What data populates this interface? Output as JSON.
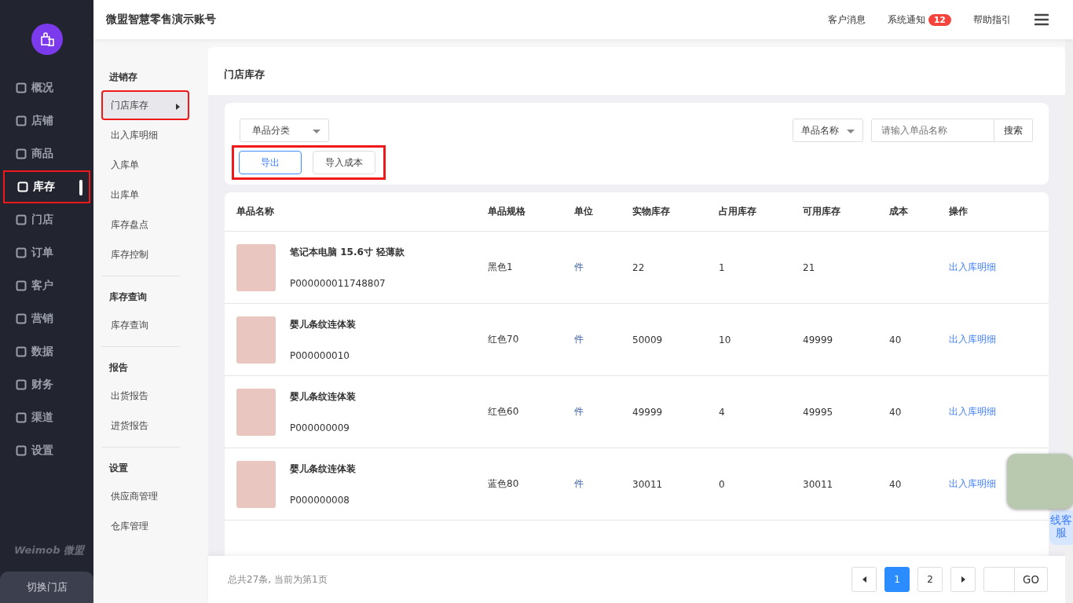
{
  "sidebar": {
    "nav": [
      {
        "label": "概况",
        "selected": false,
        "highlighted": false
      },
      {
        "label": "店铺",
        "selected": false,
        "highlighted": false
      },
      {
        "label": "商品",
        "selected": false,
        "highlighted": false
      },
      {
        "label": "库存",
        "selected": true,
        "highlighted": true
      },
      {
        "label": "门店",
        "selected": false,
        "highlighted": false
      },
      {
        "label": "订单",
        "selected": false,
        "highlighted": false
      },
      {
        "label": "客户",
        "selected": false,
        "highlighted": false
      },
      {
        "label": "营销",
        "selected": false,
        "highlighted": false
      },
      {
        "label": "数据",
        "selected": false,
        "highlighted": false
      },
      {
        "label": "财务",
        "selected": false,
        "highlighted": false
      },
      {
        "label": "渠道",
        "selected": false,
        "highlighted": false
      },
      {
        "label": "设置",
        "selected": false,
        "highlighted": false
      }
    ],
    "brand": "Weimob 微盟",
    "switch_store": "切换门店"
  },
  "submenu": [
    {
      "title": "进销存",
      "items": [
        {
          "label": "门店库存",
          "selected": true,
          "highlighted": true
        },
        {
          "label": "出入库明细",
          "selected": false,
          "highlighted": false
        },
        {
          "label": "入库单",
          "selected": false,
          "highlighted": false
        },
        {
          "label": "出库单",
          "selected": false,
          "highlighted": false
        },
        {
          "label": "库存盘点",
          "selected": false,
          "highlighted": false
        },
        {
          "label": "库存控制",
          "selected": false,
          "highlighted": false
        }
      ]
    },
    {
      "title": "库存查询",
      "items": [
        {
          "label": "库存查询",
          "selected": false,
          "highlighted": false
        }
      ]
    },
    {
      "title": "报告",
      "items": [
        {
          "label": "出货报告",
          "selected": false,
          "highlighted": false
        },
        {
          "label": "进货报告",
          "selected": false,
          "highlighted": false
        }
      ]
    },
    {
      "title": "设置",
      "items": [
        {
          "label": "供应商管理",
          "selected": false,
          "highlighted": false
        },
        {
          "label": "仓库管理",
          "selected": false,
          "highlighted": false
        }
      ]
    }
  ],
  "header": {
    "title": "微盟智慧零售演示账号",
    "links": [
      {
        "label": "客户消息"
      },
      {
        "label": "系统通知",
        "badge": "12"
      },
      {
        "label": "帮助指引"
      }
    ]
  },
  "page_title": "门店库存",
  "filters": {
    "category": "单品分类",
    "search_by": "单品名称",
    "search_placeholder": "请输入单品名称",
    "search_button": "搜索"
  },
  "actions": {
    "highlighted": true,
    "buttons": [
      {
        "label": "导出",
        "primary": true
      },
      {
        "label": "导入成本",
        "primary": false
      }
    ]
  },
  "table": {
    "columns": [
      "单品名称",
      "单品规格",
      "单位",
      "实物库存",
      "占用库存",
      "可用库存",
      "成本",
      "操作"
    ],
    "rows": [
      {
        "name": "笔记本电脑 15.6寸 轻薄款",
        "code": "P000000011748807",
        "spec": "黑色1",
        "unit": "件",
        "stock": "22",
        "reserved": "1",
        "available": "21",
        "action": "出入库明细"
      },
      {
        "name": "婴儿条纹连体装",
        "code": "P000000010",
        "spec": "红色70",
        "unit": "件",
        "stock": "50009",
        "reserved": "10",
        "available": "49999",
        "cost": "40",
        "action": "出入库明细"
      },
      {
        "name": "婴儿条纹连体装",
        "code": "P000000009",
        "spec": "红色60",
        "unit": "件",
        "stock": "49999",
        "reserved": "4",
        "available": "49995",
        "cost": "40",
        "action": "出入库明细"
      },
      {
        "name": "婴儿条纹连体装",
        "code": "P000000008",
        "spec": "蓝色80",
        "unit": "件",
        "stock": "30011",
        "reserved": "0",
        "available": "30011",
        "cost": "40",
        "action": "出入库明细"
      }
    ]
  },
  "footer": {
    "summary": "总共27条, 当前为第1页",
    "pages": [
      {
        "label": "1",
        "selected": true
      },
      {
        "label": "2",
        "selected": false
      }
    ],
    "go": "GO"
  },
  "service_tab": "线客服"
}
